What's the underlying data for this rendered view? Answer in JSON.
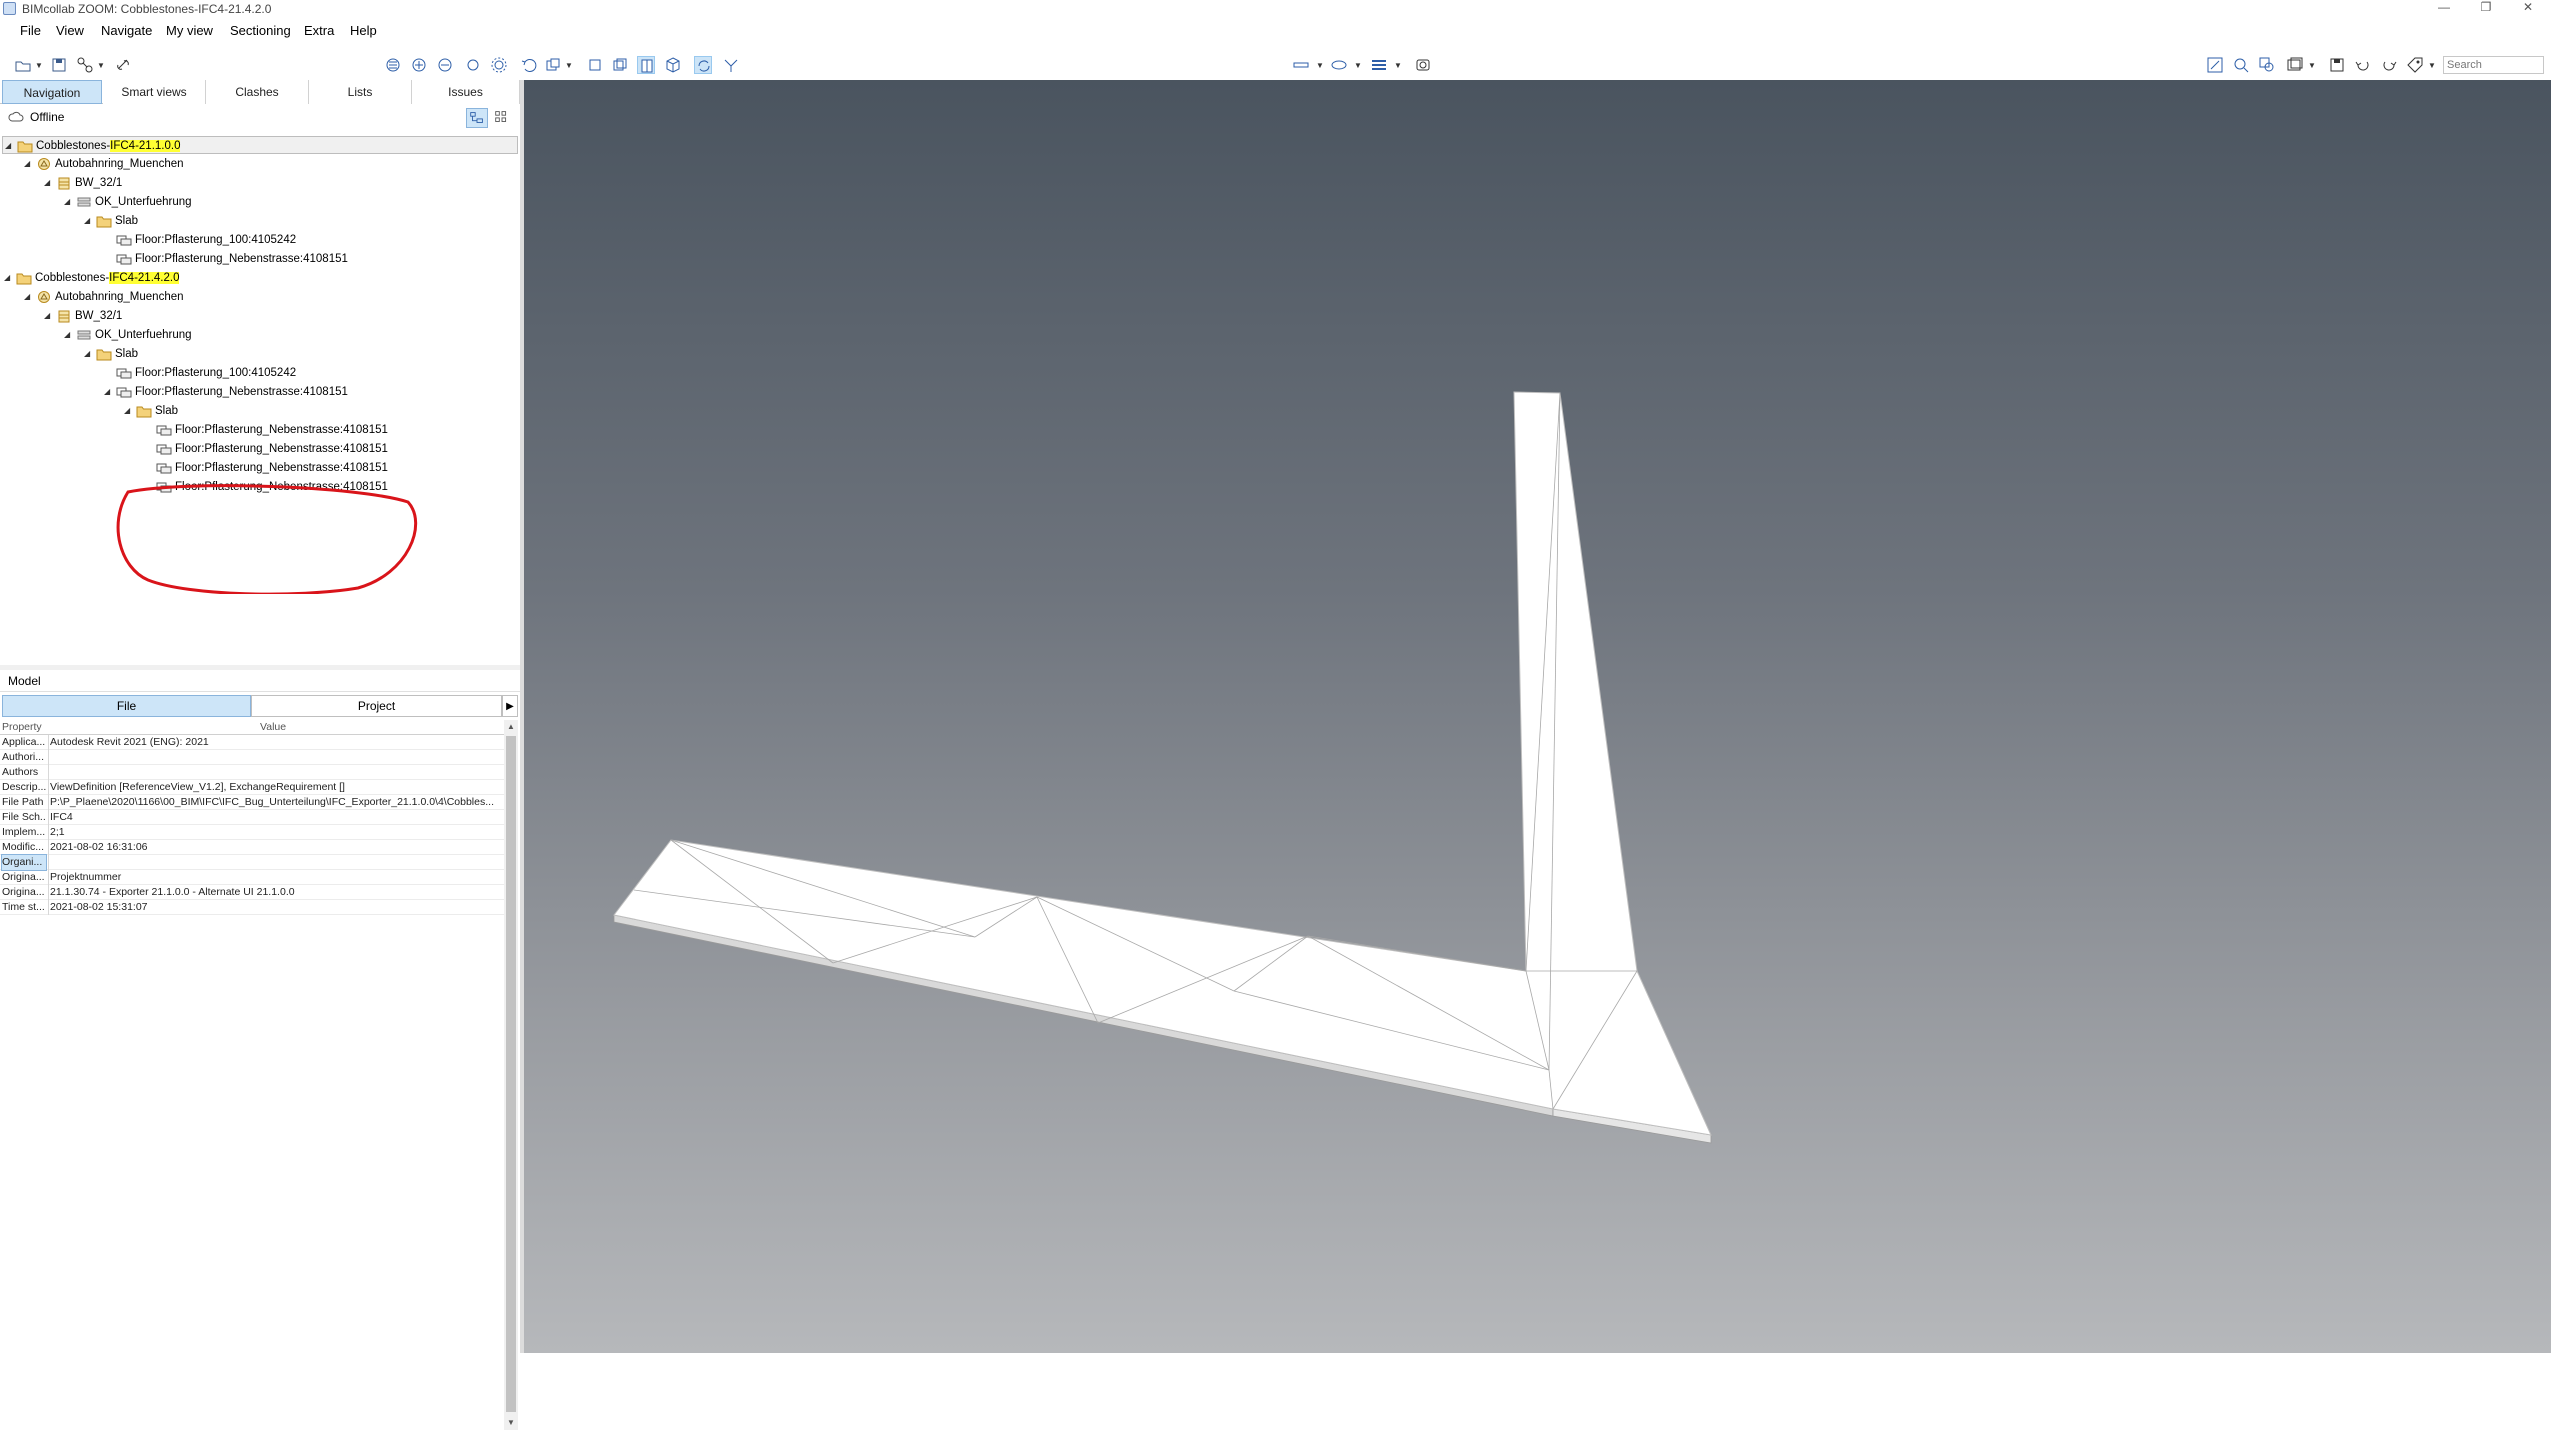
{
  "window": {
    "title": "BIMcollab ZOOM: Cobblestones-IFC4-21.4.2.0",
    "minimize": "—",
    "restore": "❐",
    "close": "✕"
  },
  "menu": [
    "File",
    "View",
    "Navigate",
    "My view",
    "Sectioning",
    "Extra",
    "Help"
  ],
  "toolbar": {
    "search_placeholder": "Search"
  },
  "tabs": [
    {
      "label": "Navigation",
      "active": true
    },
    {
      "label": "Smart views",
      "active": false
    },
    {
      "label": "Clashes",
      "active": false
    },
    {
      "label": "Lists",
      "active": false
    },
    {
      "label": "Issues",
      "active": false
    }
  ],
  "status": {
    "label": "Offline"
  },
  "tree": [
    {
      "level": 0,
      "icon": "folder-icon",
      "prefix": "Cobblestones-",
      "highlight": "IFC4-21.1.0.0",
      "selected": true
    },
    {
      "level": 1,
      "icon": "site-icon",
      "label": "Autobahnring_Muenchen"
    },
    {
      "level": 2,
      "icon": "building-icon",
      "label": "BW_32/1"
    },
    {
      "level": 3,
      "icon": "storey-icon",
      "label": "OK_Unterfuehrung"
    },
    {
      "level": 4,
      "icon": "folder-icon",
      "label": "Slab"
    },
    {
      "level": 5,
      "icon": "slab-icon",
      "label": "Floor:Pflasterung_100:4105242"
    },
    {
      "level": 5,
      "icon": "slab-icon",
      "label": "Floor:Pflasterung_Nebenstrasse:4108151"
    },
    {
      "level": 0,
      "icon": "folder-icon",
      "prefix": "Cobblestones-",
      "highlight": "IFC4-21.4.2.0"
    },
    {
      "level": 1,
      "icon": "site-icon",
      "label": "Autobahnring_Muenchen"
    },
    {
      "level": 2,
      "icon": "building-icon",
      "label": "BW_32/1"
    },
    {
      "level": 3,
      "icon": "storey-icon",
      "label": "OK_Unterfuehrung"
    },
    {
      "level": 4,
      "icon": "folder-icon",
      "label": "Slab"
    },
    {
      "level": 5,
      "icon": "slab-icon",
      "label": "Floor:Pflasterung_100:4105242"
    },
    {
      "level": 5,
      "icon": "slab-icon",
      "label": "Floor:Pflasterung_Nebenstrasse:4108151",
      "expanded": true
    },
    {
      "level": 6,
      "icon": "folder-icon",
      "label": "Slab"
    },
    {
      "level": 7,
      "icon": "slab-icon",
      "label": "Floor:Pflasterung_Nebenstrasse:4108151"
    },
    {
      "level": 7,
      "icon": "slab-icon",
      "label": "Floor:Pflasterung_Nebenstrasse:4108151"
    },
    {
      "level": 7,
      "icon": "slab-icon",
      "label": "Floor:Pflasterung_Nebenstrasse:4108151"
    },
    {
      "level": 7,
      "icon": "slab-icon",
      "label": "Floor:Pflasterung_Nebenstrasse:4108151"
    }
  ],
  "model": {
    "header": "Model",
    "subtabs": [
      "File",
      "Project"
    ],
    "columns": [
      "Property",
      "Value"
    ],
    "rows": [
      {
        "key": "Applica...",
        "value": "Autodesk Revit 2021 (ENG): 2021"
      },
      {
        "key": "Authori...",
        "value": ""
      },
      {
        "key": "Authors",
        "value": ""
      },
      {
        "key": "Descrip...",
        "value": "ViewDefinition [ReferenceView_V1.2], ExchangeRequirement []"
      },
      {
        "key": "File Path",
        "value": "P:\\P_Plaene\\2020\\1166\\00_BIM\\IFC\\IFC_Bug_Unterteilung\\IFC_Exporter_21.1.0.0\\4\\Cobbles..."
      },
      {
        "key": "File Sch...",
        "value": "IFC4"
      },
      {
        "key": "Implem...",
        "value": "2;1"
      },
      {
        "key": "Modific...",
        "value": "2021-08-02 16:31:06"
      },
      {
        "key": "Organi...",
        "value": "",
        "selected": true
      },
      {
        "key": "Origina...",
        "value": "Projektnummer"
      },
      {
        "key": "Origina...",
        "value": "21.1.30.74 - Exporter 21.1.0.0 - Alternate UI 21.1.0.0"
      },
      {
        "key": "Time st...",
        "value": "2021-08-02 15:31:07"
      }
    ]
  },
  "colors": {
    "highlight": "#ffff33",
    "annotation": "#d9141a",
    "tab_active": "#cde5f8"
  }
}
